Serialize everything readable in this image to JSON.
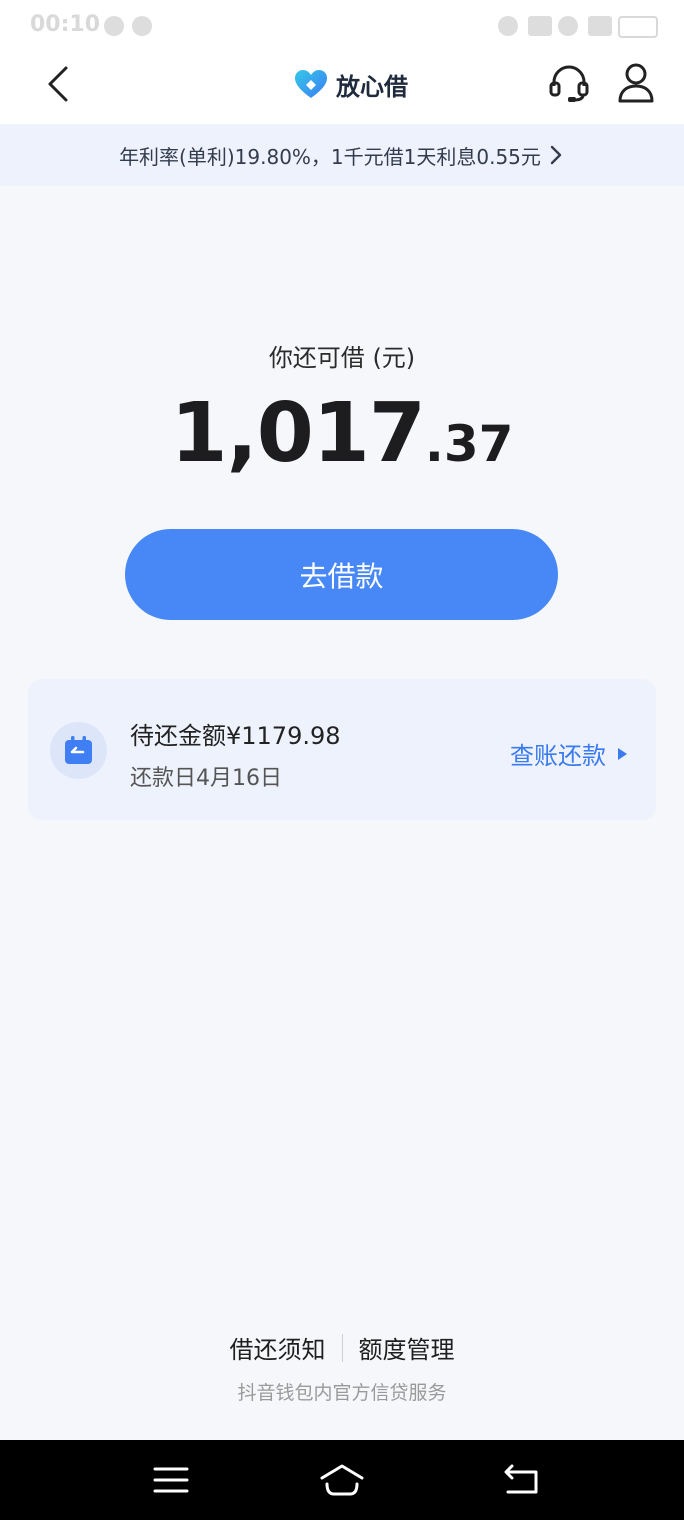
{
  "status_bar": {
    "time": "00:10"
  },
  "header": {
    "brand_name": "放心借",
    "icons": {
      "back": "back-arrow-icon",
      "logo": "heart-shield-logo",
      "support": "headset-icon",
      "profile": "user-icon"
    }
  },
  "rate_banner": {
    "text": "年利率(单利)19.80%，1千元借1天利息0.55元"
  },
  "main": {
    "available_label": "你还可借 (元)",
    "amount_integer": "1,017",
    "amount_decimal": ".37",
    "borrow_button_label": "去借款"
  },
  "repay_card": {
    "due_amount": "待还金额¥1179.98",
    "due_date": "还款日4月16日",
    "link_label": "查账还款"
  },
  "footer": {
    "link_terms": "借还须知",
    "link_limit": "额度管理",
    "tagline": "抖音钱包内官方信贷服务"
  },
  "colors": {
    "accent": "#4788f6",
    "link": "#3b7bf0",
    "banner_bg": "#eef2fc",
    "page_bg": "#f5f7fa"
  }
}
